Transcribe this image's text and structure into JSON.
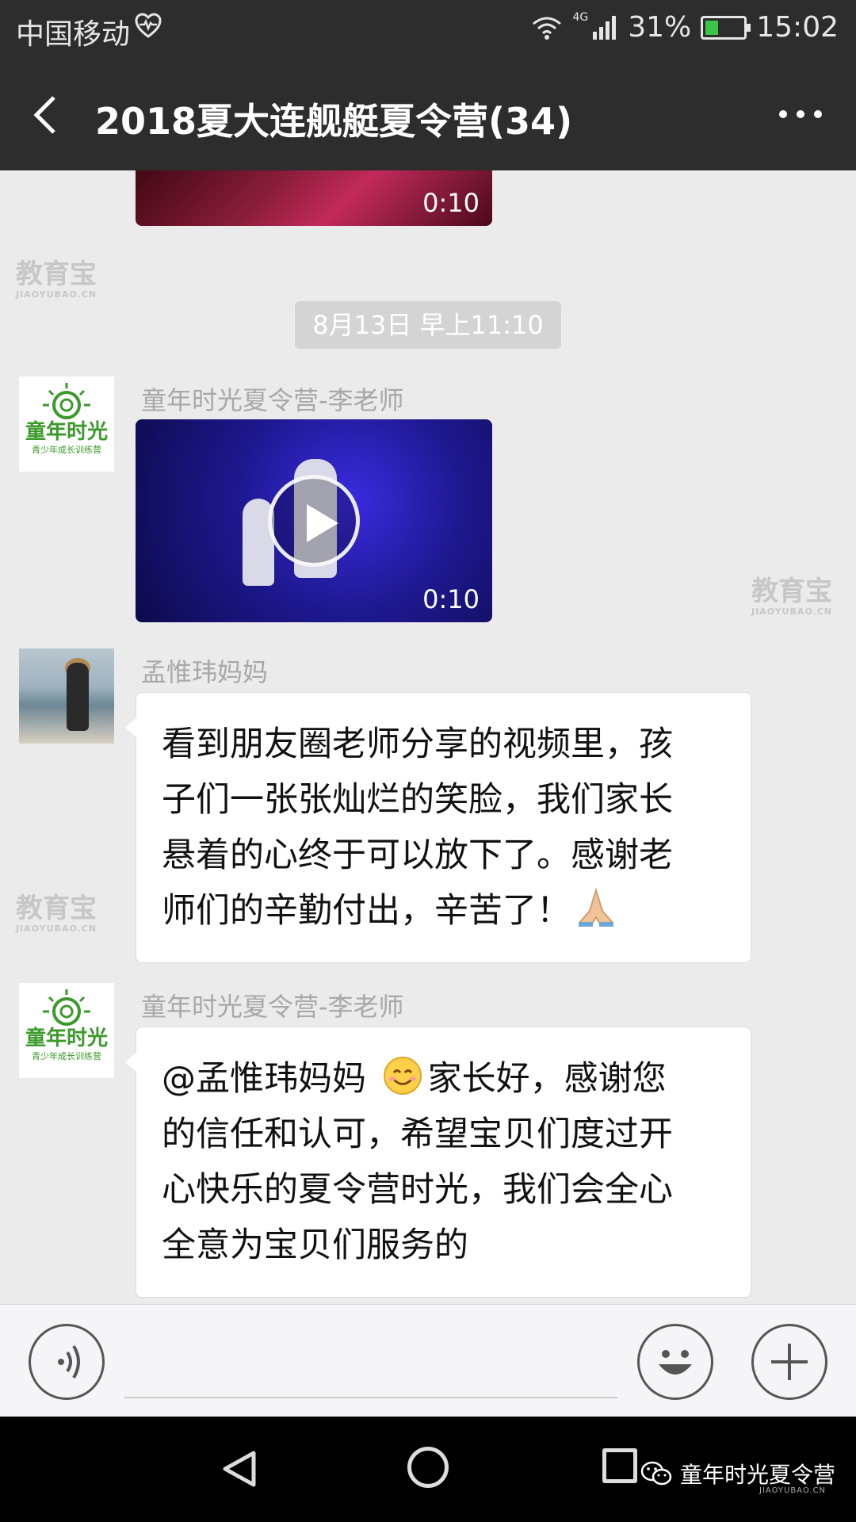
{
  "status_bar": {
    "carrier": "中国移动",
    "network": "4G",
    "battery": "31%",
    "time": "15:02"
  },
  "header": {
    "title": "2018夏大连舰艇夏令营(34)"
  },
  "messages": [
    {
      "type": "video",
      "duration": "0:10"
    },
    {
      "type": "timestamp",
      "text": "8月13日 早上11:10"
    },
    {
      "type": "video",
      "sender": "童年时光夏令营-李老师",
      "duration": "0:10"
    },
    {
      "type": "text",
      "sender": "孟惟玮妈妈",
      "lines": [
        "看到朋友圈老师分享的视频里，孩",
        "子们一张张灿烂的笑脸，我们家长",
        "悬着的心终于可以放下了。感谢老",
        "师们的辛勤付出，辛苦了！"
      ]
    },
    {
      "type": "text",
      "sender": "童年时光夏令营-李老师",
      "lines": [
        "@孟惟玮妈妈 ",
        "家长好，感谢您",
        "的信任和认可，希望宝贝们度过开",
        "心快乐的夏令营时光，我们会全心",
        "全意为宝贝们服务的"
      ]
    }
  ],
  "logo": {
    "name": "童年时光",
    "tagline": "青少年成长训练营"
  },
  "watermark": {
    "text": "教育宝",
    "url": "JIAOYUBAO.CN"
  },
  "footer_brand": {
    "name": "童年时光夏令营",
    "url": "JIAOYUBAO.CN"
  },
  "icons": [
    "heart-icon",
    "wifi-icon",
    "signal-icon",
    "battery-icon",
    "back-icon",
    "more-icon",
    "play-icon",
    "pray-emoji",
    "smile-emoji",
    "voice-icon",
    "emoji-icon",
    "plus-icon",
    "nav-back-icon",
    "nav-home-icon",
    "nav-recent-icon",
    "wechat-icon"
  ],
  "colors": {
    "header_bg": "#2d2d2d",
    "chat_bg": "#ebebeb",
    "logo_green": "#3a9a2a"
  }
}
